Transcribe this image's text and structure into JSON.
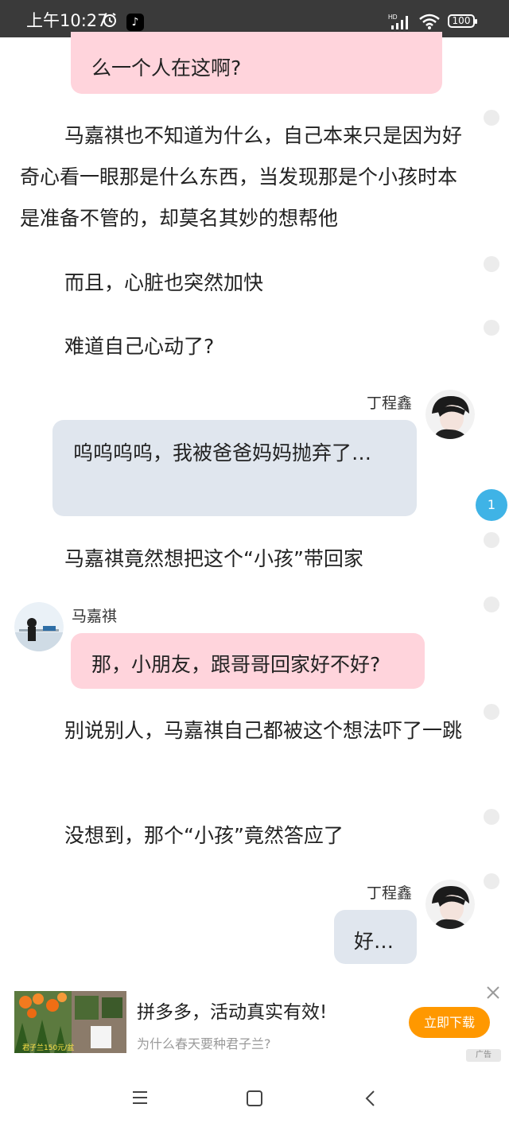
{
  "status_bar": {
    "time": "上午10:27",
    "icons": [
      "alarm-icon",
      "tiktok-icon",
      "hd-signal-icon",
      "wifi-icon",
      "battery-icon"
    ],
    "battery": "100",
    "hd": "HD"
  },
  "story": {
    "bubble_top": {
      "text": "么一个人在这啊?"
    },
    "para1": "马嘉祺也不知道为什么，自己本来只是因为好奇心看一眼那是什么东西，当发现那是个小孩时本是准备不管的，却莫名其妙的想帮他",
    "para2": "而且，心脏也突然加快",
    "para3": "难道自己心动了?",
    "msg1": {
      "name": "丁程鑫",
      "text": "呜呜呜呜，我被爸爸妈妈抛弃了…"
    },
    "para4": "马嘉祺竟然想把这个“小孩”带回家",
    "msg2": {
      "name": "马嘉祺",
      "text": "那，小朋友，跟哥哥回家好不好?"
    },
    "para5": "别说别人，马嘉祺自己都被这个想法吓了一跳",
    "para6": "没想到，那个“小孩”竟然答应了",
    "msg3": {
      "name": "丁程鑫",
      "text": "好…"
    },
    "comment_badge": "1"
  },
  "ad": {
    "title": "拼多多，活动真实有效!",
    "subtitle": "为什么春天要种君子兰?",
    "button": "立即下载",
    "tag": "广告",
    "thumb_caption": "君子兰150元/盆"
  },
  "colors": {
    "accent_pink": "#ffd4dc",
    "accent_blue_bubble": "#e0e6ee",
    "badge_blue": "#3fb3e6",
    "download_orange": "#ff9800"
  }
}
